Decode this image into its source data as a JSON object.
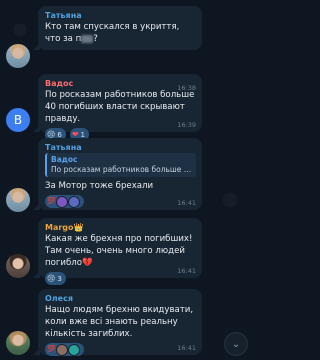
{
  "messages": [
    {
      "author": "Татьяна",
      "author_color": "#4fa3e0",
      "text_pre": "Кто там спускался в укриття, что за п",
      "text_post": "?",
      "time": ""
    },
    {
      "author": "Вадос",
      "author_color": "#ff6e6e",
      "text": "По росказам работников больше 40 погибших  власти скрывают правду.",
      "time": "16:38",
      "reactions": [
        {
          "emoji": "😢",
          "count": "6",
          "icon": "crying-face-icon"
        },
        {
          "emoji": "❤",
          "count": "1",
          "icon": "heart-icon"
        }
      ],
      "time2": "16:39"
    },
    {
      "author": "Татьяна",
      "author_color": "#4fa3e0",
      "quote_name": "Вадос",
      "quote_text": "По росказам работников больше 40 погибш...",
      "text": "За Мотор тоже брехали",
      "time": "16:41",
      "reactions": [
        {
          "emoji": "💯",
          "count": "",
          "icon": "hundred-points-icon"
        }
      ]
    },
    {
      "author": "Margo",
      "author_badge": "👑",
      "author_color": "#e8a33a",
      "text": "Какая же брехня про погибших! Там очень, очень много людей погибло💔",
      "time": "16:41",
      "reactions": [
        {
          "emoji": "😢",
          "count": "3",
          "icon": "crying-face-icon"
        }
      ]
    },
    {
      "author": "Олеся",
      "author_color": "#4fa3e0",
      "text": "Нащо людям брехню вкидувати,  коли вже всі знають реальну кількість загиблих.",
      "time": "16:41",
      "reactions": [
        {
          "emoji": "💯",
          "count": "",
          "icon": "hundred-points-icon"
        }
      ]
    }
  ],
  "avatar_letter_b": "B",
  "scroll_down_icon": "chevron-down-icon"
}
